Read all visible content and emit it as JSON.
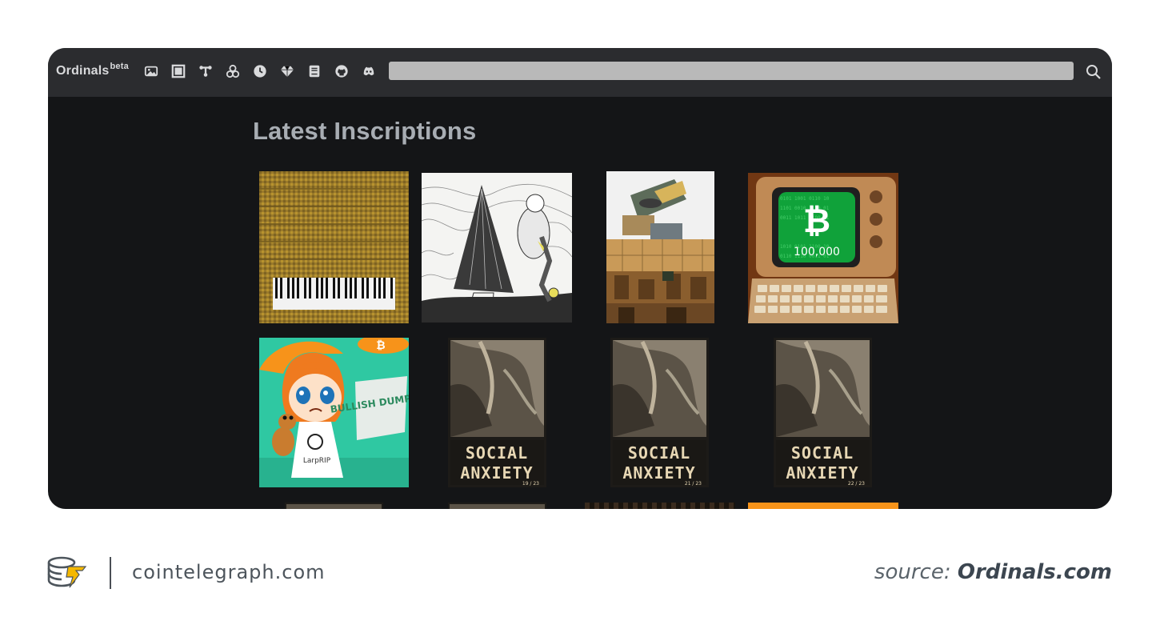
{
  "navbar": {
    "brand": "Ordinals",
    "brand_sup": "beta",
    "icons": [
      "images-icon",
      "block-icon",
      "transaction-icon",
      "sat-icon",
      "clock-icon",
      "gem-icon",
      "book-icon",
      "github-icon",
      "discord-icon"
    ],
    "search_placeholder": ""
  },
  "main": {
    "title": "Latest Inscriptions",
    "inscriptions": [
      {
        "name": "piano-inscription"
      },
      {
        "name": "sketch-inscription"
      },
      {
        "name": "collage-inscription"
      },
      {
        "name": "bitcoin-computer-inscription",
        "screen_text": "100,000"
      },
      {
        "name": "bullish-dumping-inscription",
        "sign_text": "BULLISH DUMPING",
        "shirt_text": "LarpRIP"
      },
      {
        "name": "social-anxiety-19",
        "line1": "SOCIAL",
        "line2": "ANXIETY",
        "edition": "19 / 23"
      },
      {
        "name": "social-anxiety-21",
        "line1": "SOCIAL",
        "line2": "ANXIETY",
        "edition": "21 / 23"
      },
      {
        "name": "social-anxiety-22",
        "line1": "SOCIAL",
        "line2": "ANXIETY",
        "edition": "22 / 23"
      }
    ]
  },
  "footer": {
    "site": "cointelegraph.com",
    "source_prefix": "source:",
    "source_name": "Ordinals.com"
  },
  "colors": {
    "window_bg": "#141517",
    "navbar_bg": "#2b2c2f",
    "title": "#a8adb3",
    "search_bg": "#b9b9b9"
  }
}
